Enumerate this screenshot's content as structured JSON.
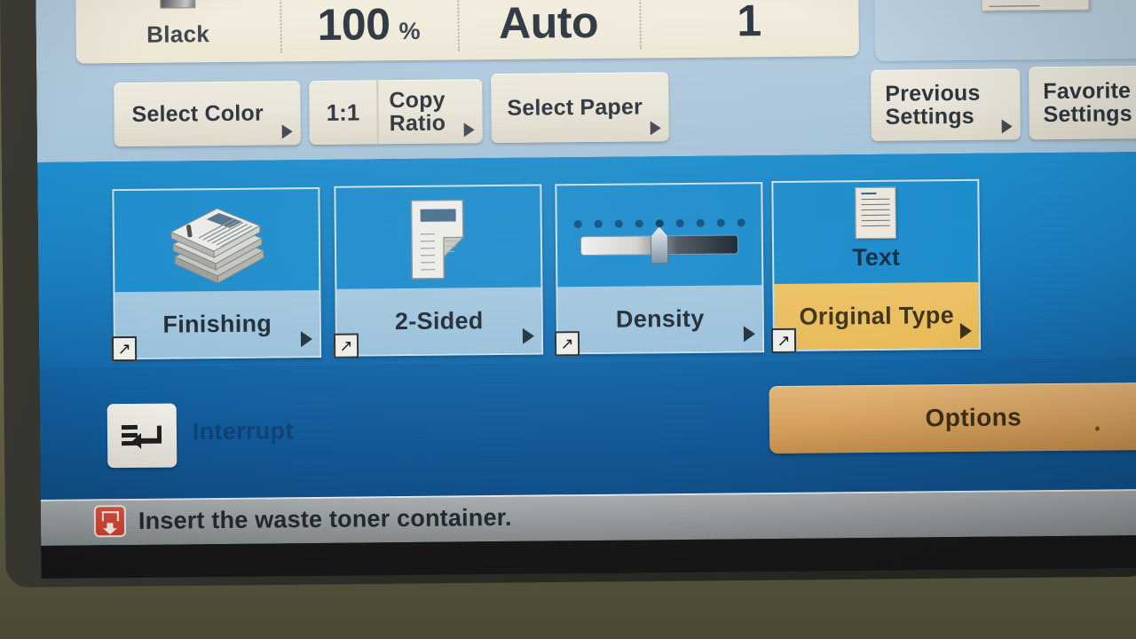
{
  "device": {
    "type": "copier-control-panel"
  },
  "summary": {
    "color": {
      "value": "Black",
      "swatch_icon": "black-gradient-swatch"
    },
    "ratio": {
      "value": "100",
      "unit": "%"
    },
    "paper": {
      "value": "Auto"
    },
    "quantity": {
      "value": "1"
    }
  },
  "preview": {
    "doc_icon": "document-lines-thumbnail",
    "arrow_icon": "triangle-right-icon"
  },
  "quick_buttons": [
    {
      "name": "select-color",
      "label": "Select Color",
      "arrow": "triangle-right-icon"
    },
    {
      "name": "copy-ratio",
      "left_value": "1:1",
      "label": "Copy\nRatio",
      "arrow": "triangle-right-icon"
    },
    {
      "name": "select-paper",
      "label": "Select Paper",
      "arrow": "triangle-right-icon"
    },
    {
      "name": "previous-settings",
      "label": "Previous\nSettings",
      "arrow": "triangle-right-icon"
    },
    {
      "name": "favorite-settings",
      "label": "Favorite\nSettings",
      "arrow": "triangle-right-icon"
    }
  ],
  "tiles": [
    {
      "name": "finishing",
      "label": "Finishing",
      "icon": "stapled-stack-icon",
      "selected": false,
      "shortcut_icon": "arrow-up-right-icon",
      "arrow": "triangle-right-icon"
    },
    {
      "name": "two-sided",
      "label": "2-Sided",
      "icon": "folded-page-icon",
      "selected": false,
      "shortcut_icon": "arrow-up-right-icon",
      "arrow": "triangle-right-icon"
    },
    {
      "name": "density",
      "label": "Density",
      "icon": "density-slider-icon",
      "selected": false,
      "shortcut_icon": "arrow-up-right-icon",
      "arrow": "triangle-right-icon"
    },
    {
      "name": "original-type",
      "label": "Original Type",
      "icon": "text-document-icon",
      "value": "Text",
      "selected": true,
      "shortcut_icon": "arrow-up-right-icon",
      "arrow": "triangle-right-icon"
    }
  ],
  "density": {
    "steps": 9,
    "selected_index": 4
  },
  "bottom": {
    "interrupt": {
      "label": "Interrupt",
      "icon": "interrupt-arrow-icon"
    },
    "options": {
      "label": "Options",
      "arrow": "triangle-right-icon"
    }
  },
  "status": {
    "icon": "waste-toner-alert-icon",
    "message": "Insert the waste toner container."
  },
  "colors": {
    "panel_cream": "#f4efdd",
    "screen_blue_light": "#b2cde1",
    "screen_blue_mid": "#1680c4",
    "screen_blue_dark": "#0d5798",
    "tile_label": "#9dc5e0",
    "tile_label_selected": "#eebe57",
    "options_gold": "#dca45e",
    "alert_red": "#d8402c",
    "statusbar_gray": "#9aa0a2"
  }
}
